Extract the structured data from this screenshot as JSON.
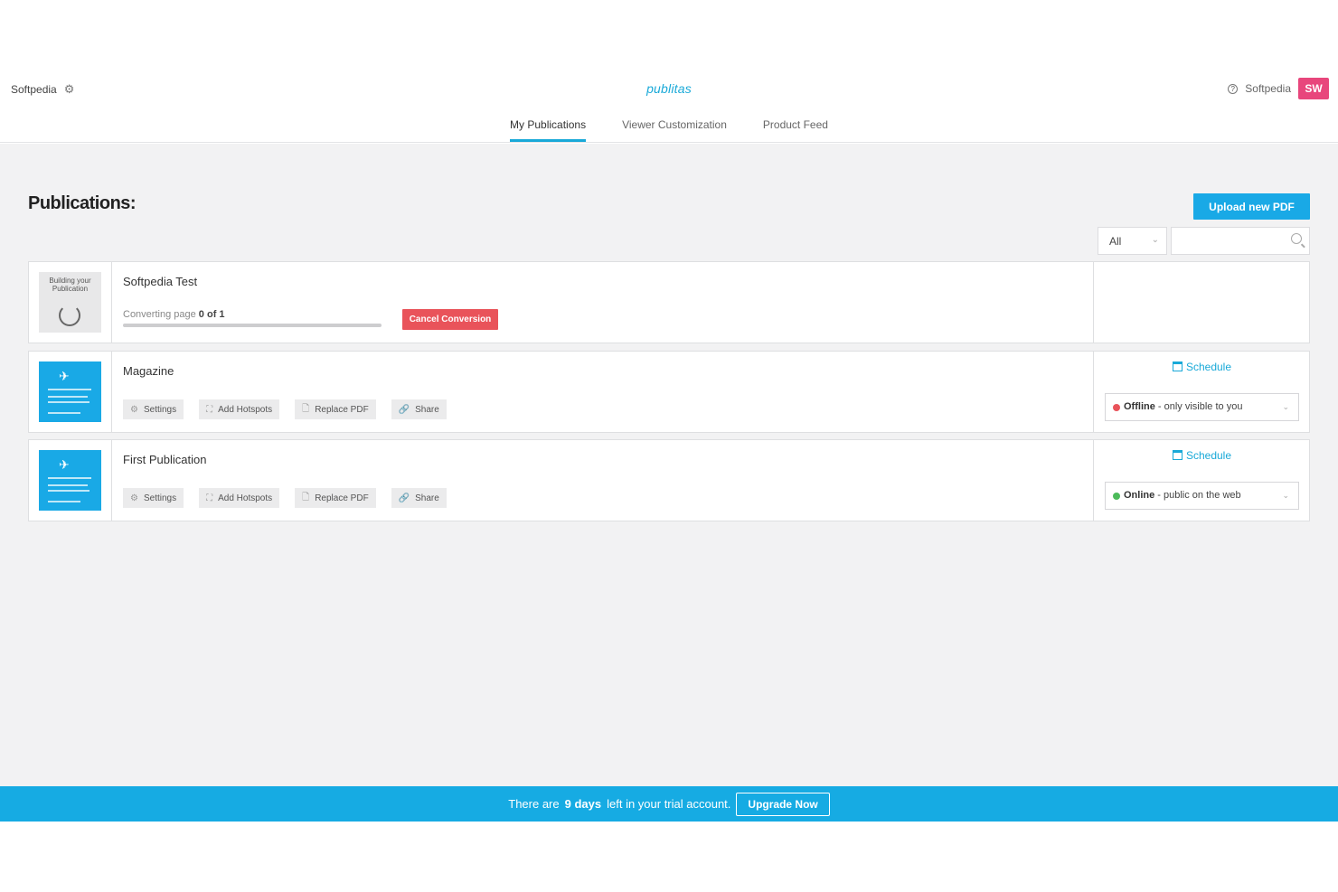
{
  "header": {
    "account_name": "Softpedia",
    "logo": "publitas",
    "user_name": "Softpedia",
    "user_initials": "SW",
    "help_icon": "question-icon",
    "settings_icon": "gear-icon"
  },
  "tabs": [
    {
      "label": "My Publications",
      "active": true
    },
    {
      "label": "Viewer Customization",
      "active": false
    },
    {
      "label": "Product Feed",
      "active": false
    }
  ],
  "main": {
    "title": "Publications:",
    "upload_label": "Upload new PDF",
    "filter_value": "All",
    "search_placeholder": ""
  },
  "publications": [
    {
      "name": "Softpedia Test",
      "thumb_text": "Building your Publication",
      "converting_prefix": "Converting page",
      "converting_value": "0 of 1",
      "progress": 0,
      "cancel_label": "Cancel Conversion"
    },
    {
      "name": "Magazine",
      "actions": [
        "Settings",
        "Add Hotspots",
        "Replace PDF",
        "Share"
      ],
      "schedule_label": "Schedule",
      "status_strong": "Offline",
      "status_rest": " - only visible to you",
      "status_color": "#e9535a"
    },
    {
      "name": "First Publication",
      "actions": [
        "Settings",
        "Add Hotspots",
        "Replace PDF",
        "Share"
      ],
      "schedule_label": "Schedule",
      "status_strong": "Online",
      "status_rest": " - public on the web",
      "status_color": "#4cbb5a"
    }
  ],
  "banner": {
    "prefix": "There are",
    "days": "9 days",
    "suffix": "left in your trial account.",
    "upgrade_label": "Upgrade Now"
  },
  "colors": {
    "accent": "#19a9e6",
    "danger": "#e9535a",
    "avatar": "#e8467c"
  }
}
